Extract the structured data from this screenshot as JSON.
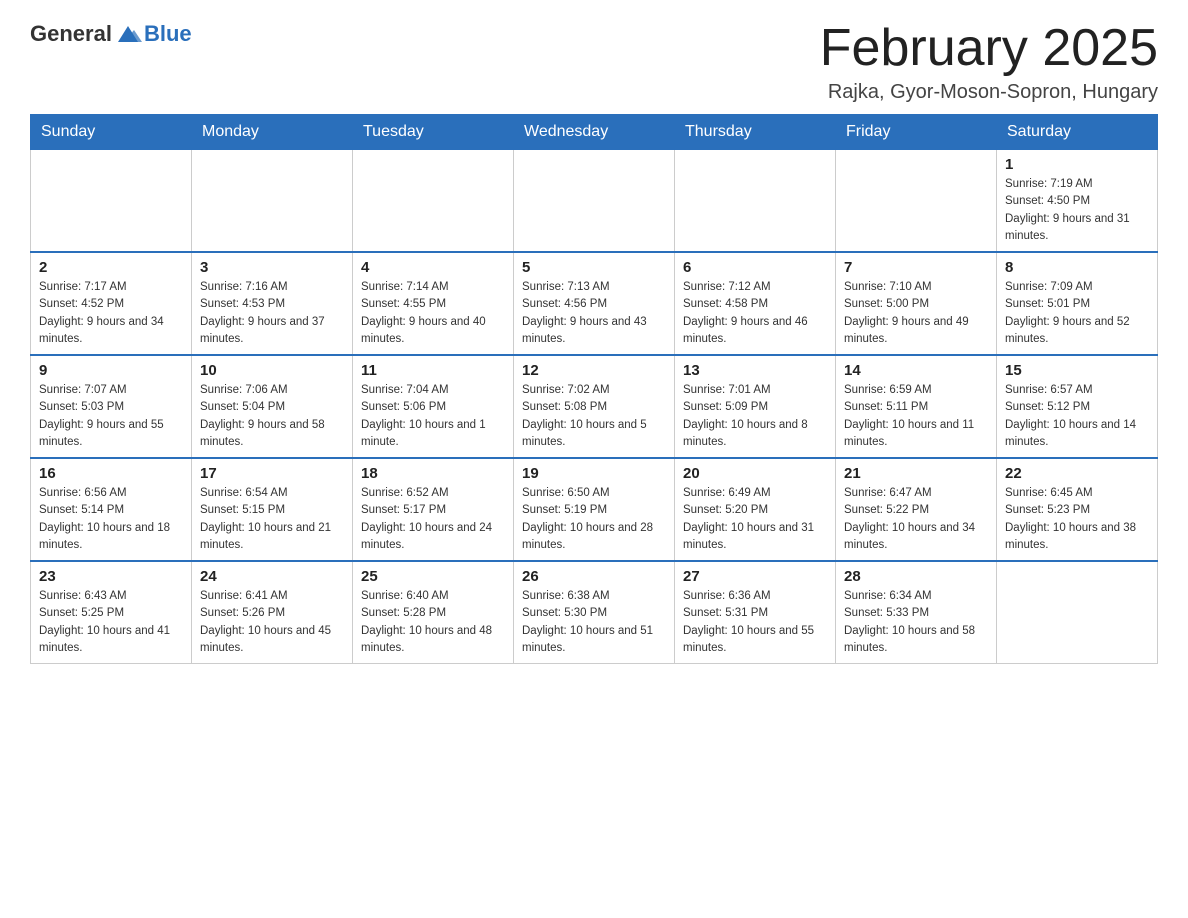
{
  "header": {
    "logo_general": "General",
    "logo_blue": "Blue",
    "month_title": "February 2025",
    "location": "Rajka, Gyor-Moson-Sopron, Hungary"
  },
  "days_of_week": [
    "Sunday",
    "Monday",
    "Tuesday",
    "Wednesday",
    "Thursday",
    "Friday",
    "Saturday"
  ],
  "weeks": [
    [
      {
        "day": "",
        "info": ""
      },
      {
        "day": "",
        "info": ""
      },
      {
        "day": "",
        "info": ""
      },
      {
        "day": "",
        "info": ""
      },
      {
        "day": "",
        "info": ""
      },
      {
        "day": "",
        "info": ""
      },
      {
        "day": "1",
        "info": "Sunrise: 7:19 AM\nSunset: 4:50 PM\nDaylight: 9 hours and 31 minutes."
      }
    ],
    [
      {
        "day": "2",
        "info": "Sunrise: 7:17 AM\nSunset: 4:52 PM\nDaylight: 9 hours and 34 minutes."
      },
      {
        "day": "3",
        "info": "Sunrise: 7:16 AM\nSunset: 4:53 PM\nDaylight: 9 hours and 37 minutes."
      },
      {
        "day": "4",
        "info": "Sunrise: 7:14 AM\nSunset: 4:55 PM\nDaylight: 9 hours and 40 minutes."
      },
      {
        "day": "5",
        "info": "Sunrise: 7:13 AM\nSunset: 4:56 PM\nDaylight: 9 hours and 43 minutes."
      },
      {
        "day": "6",
        "info": "Sunrise: 7:12 AM\nSunset: 4:58 PM\nDaylight: 9 hours and 46 minutes."
      },
      {
        "day": "7",
        "info": "Sunrise: 7:10 AM\nSunset: 5:00 PM\nDaylight: 9 hours and 49 minutes."
      },
      {
        "day": "8",
        "info": "Sunrise: 7:09 AM\nSunset: 5:01 PM\nDaylight: 9 hours and 52 minutes."
      }
    ],
    [
      {
        "day": "9",
        "info": "Sunrise: 7:07 AM\nSunset: 5:03 PM\nDaylight: 9 hours and 55 minutes."
      },
      {
        "day": "10",
        "info": "Sunrise: 7:06 AM\nSunset: 5:04 PM\nDaylight: 9 hours and 58 minutes."
      },
      {
        "day": "11",
        "info": "Sunrise: 7:04 AM\nSunset: 5:06 PM\nDaylight: 10 hours and 1 minute."
      },
      {
        "day": "12",
        "info": "Sunrise: 7:02 AM\nSunset: 5:08 PM\nDaylight: 10 hours and 5 minutes."
      },
      {
        "day": "13",
        "info": "Sunrise: 7:01 AM\nSunset: 5:09 PM\nDaylight: 10 hours and 8 minutes."
      },
      {
        "day": "14",
        "info": "Sunrise: 6:59 AM\nSunset: 5:11 PM\nDaylight: 10 hours and 11 minutes."
      },
      {
        "day": "15",
        "info": "Sunrise: 6:57 AM\nSunset: 5:12 PM\nDaylight: 10 hours and 14 minutes."
      }
    ],
    [
      {
        "day": "16",
        "info": "Sunrise: 6:56 AM\nSunset: 5:14 PM\nDaylight: 10 hours and 18 minutes."
      },
      {
        "day": "17",
        "info": "Sunrise: 6:54 AM\nSunset: 5:15 PM\nDaylight: 10 hours and 21 minutes."
      },
      {
        "day": "18",
        "info": "Sunrise: 6:52 AM\nSunset: 5:17 PM\nDaylight: 10 hours and 24 minutes."
      },
      {
        "day": "19",
        "info": "Sunrise: 6:50 AM\nSunset: 5:19 PM\nDaylight: 10 hours and 28 minutes."
      },
      {
        "day": "20",
        "info": "Sunrise: 6:49 AM\nSunset: 5:20 PM\nDaylight: 10 hours and 31 minutes."
      },
      {
        "day": "21",
        "info": "Sunrise: 6:47 AM\nSunset: 5:22 PM\nDaylight: 10 hours and 34 minutes."
      },
      {
        "day": "22",
        "info": "Sunrise: 6:45 AM\nSunset: 5:23 PM\nDaylight: 10 hours and 38 minutes."
      }
    ],
    [
      {
        "day": "23",
        "info": "Sunrise: 6:43 AM\nSunset: 5:25 PM\nDaylight: 10 hours and 41 minutes."
      },
      {
        "day": "24",
        "info": "Sunrise: 6:41 AM\nSunset: 5:26 PM\nDaylight: 10 hours and 45 minutes."
      },
      {
        "day": "25",
        "info": "Sunrise: 6:40 AM\nSunset: 5:28 PM\nDaylight: 10 hours and 48 minutes."
      },
      {
        "day": "26",
        "info": "Sunrise: 6:38 AM\nSunset: 5:30 PM\nDaylight: 10 hours and 51 minutes."
      },
      {
        "day": "27",
        "info": "Sunrise: 6:36 AM\nSunset: 5:31 PM\nDaylight: 10 hours and 55 minutes."
      },
      {
        "day": "28",
        "info": "Sunrise: 6:34 AM\nSunset: 5:33 PM\nDaylight: 10 hours and 58 minutes."
      },
      {
        "day": "",
        "info": ""
      }
    ]
  ]
}
